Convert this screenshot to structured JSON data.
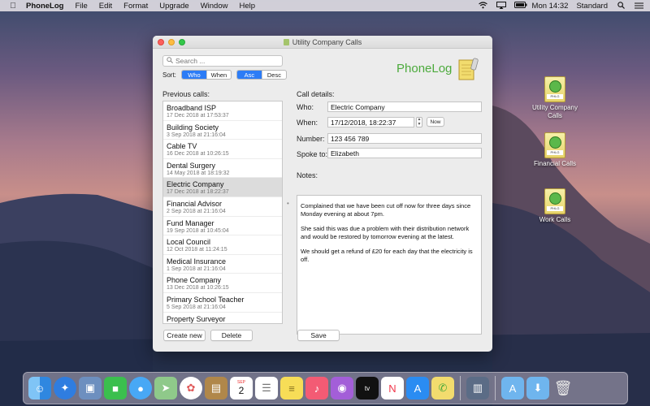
{
  "menubar": {
    "app_name": "PhoneLog",
    "items": [
      "File",
      "Edit",
      "Format",
      "Upgrade",
      "Window",
      "Help"
    ],
    "clock": "Mon 14:32",
    "keyboard": "Standard"
  },
  "window": {
    "title": "Utility Company Calls",
    "search_placeholder": "Search ...",
    "sort_label": "Sort:",
    "sort_by": [
      "Who",
      "When"
    ],
    "sort_order": [
      "Asc",
      "Desc"
    ],
    "logo": "PhoneLog",
    "previous_calls_label": "Previous calls:",
    "calls": [
      {
        "name": "Broadband ISP",
        "date": "17 Dec 2018 at 17:53:37"
      },
      {
        "name": "Building Society",
        "date": "3 Sep 2018 at 21:16:04"
      },
      {
        "name": "Cable TV",
        "date": "16 Dec 2018 at 10:26:15"
      },
      {
        "name": "Dental Surgery",
        "date": "14 May 2018 at 18:19:32"
      },
      {
        "name": "Electric Company",
        "date": "17 Dec 2018 at 18:22:37"
      },
      {
        "name": "Financial Advisor",
        "date": "2 Sep 2018 at 21:16:04"
      },
      {
        "name": "Fund Manager",
        "date": "19 Sep 2018 at 10:45:04"
      },
      {
        "name": "Local Council",
        "date": "12 Oct 2018 at 11:24:15"
      },
      {
        "name": "Medical Insurance",
        "date": "1 Sep 2018 at 21:16:04"
      },
      {
        "name": "Phone Company",
        "date": "13 Dec 2018 at 10:26:15"
      },
      {
        "name": "Primary School Teacher",
        "date": "5 Sep 2018 at 21:16:04"
      },
      {
        "name": "Property Surveyor",
        "date": ""
      }
    ],
    "create_new": "Create new",
    "delete": "Delete",
    "call_details_label": "Call details:",
    "who_label": "Who:",
    "who_value": "Electric Company",
    "when_label": "When:",
    "when_value": "17/12/2018, 18:22:37",
    "now_button": "Now",
    "number_label": "Number:",
    "number_value": "123 456 789",
    "spoke_to_label": "Spoke to:",
    "spoke_to_value": "Elizabeth",
    "notes_label": "Notes:",
    "notes": [
      "Complained that we have been cut off now for three days since Monday evening at about 7pm.",
      "She said this was due a problem with their distribution network and would be restored by tomorrow evening at the latest.",
      "We should get a refund of £20 for each day that the electricity is off."
    ],
    "save": "Save"
  },
  "desktop_icons": [
    {
      "label": "Utility Company Calls",
      "tag": "PHLG"
    },
    {
      "label": "Financial Calls",
      "tag": "PHLG"
    },
    {
      "label": "Work Calls",
      "tag": "PHLG"
    }
  ],
  "dock_apps": [
    "finder-icon",
    "safari-icon",
    "preview-icon",
    "facetime-icon",
    "messages-icon",
    "maps-icon",
    "photos-icon",
    "contacts-icon",
    "calendar-icon",
    "reminders-icon",
    "notes-icon",
    "music-icon",
    "podcasts-icon",
    "tv-icon",
    "news-icon",
    "app-store-icon",
    "phonelog-icon",
    "image-capture-icon",
    "applications-folder-icon",
    "downloads-folder-icon",
    "trash-icon"
  ],
  "calendar": {
    "month": "SEP",
    "day": "2"
  },
  "tv_label": "tv"
}
